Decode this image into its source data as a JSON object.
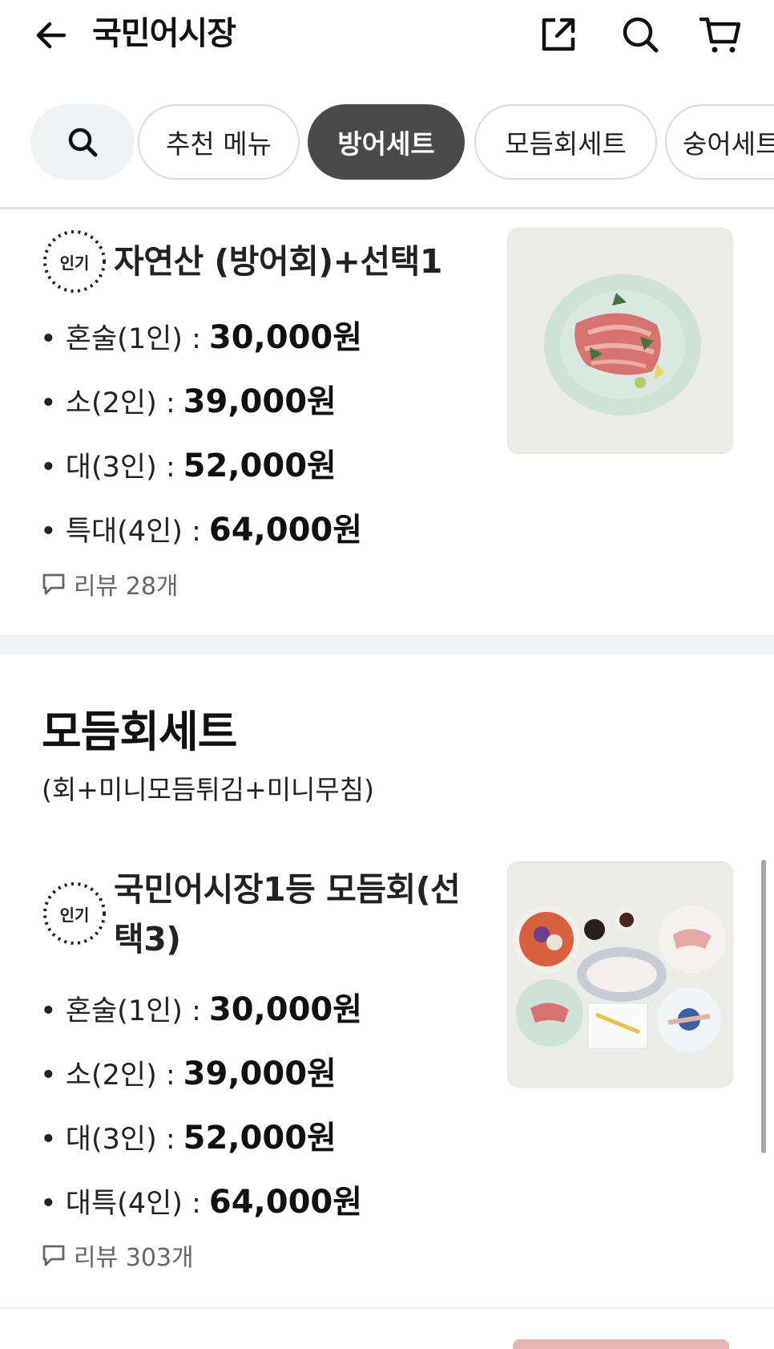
{
  "header": {
    "title": "국민어시장",
    "back_icon": "arrow-left-icon",
    "share_icon": "share-external-icon",
    "search_icon": "search-icon",
    "cart_icon": "cart-icon"
  },
  "tabs": {
    "search_icon": "search-icon",
    "items": [
      {
        "label": "추천 메뉴",
        "active": false
      },
      {
        "label": "방어세트",
        "active": true
      },
      {
        "label": "모듬회세트",
        "active": false
      },
      {
        "label": "숭어세트",
        "active": false
      }
    ]
  },
  "items": [
    {
      "badge": "인기",
      "name": "자연산 (방어회)+선택1",
      "prices": [
        {
          "label": "• 혼술(1인) :",
          "value": "30,000원"
        },
        {
          "label": "• 소(2인) :",
          "value": "39,000원"
        },
        {
          "label": "• 대(3인) :",
          "value": "52,000원"
        },
        {
          "label": "• 특대(4인) :",
          "value": "64,000원"
        }
      ],
      "review": "리뷰 28개"
    },
    {
      "badge": "인기",
      "name_line1": "국민어시장1등  모듬회(선",
      "name_line2": "택3)",
      "prices": [
        {
          "label": "• 혼술(1인) :",
          "value": "30,000원"
        },
        {
          "label": "• 소(2인) :",
          "value": "39,000원"
        },
        {
          "label": "• 대(3인) :",
          "value": "52,000원"
        },
        {
          "label": "• 대특(4인) :",
          "value": "64,000원"
        }
      ],
      "review": "리뷰 303개"
    }
  ],
  "section": {
    "title": "모듬회세트",
    "subtitle": "(회+미니모듬튀김+미니무침)"
  },
  "colors": {
    "active_tab_bg": "#4a4a4a",
    "inactive_tab_border": "#dcdcdc",
    "section_gap": "#f4f5f6",
    "review_text": "#666666"
  }
}
